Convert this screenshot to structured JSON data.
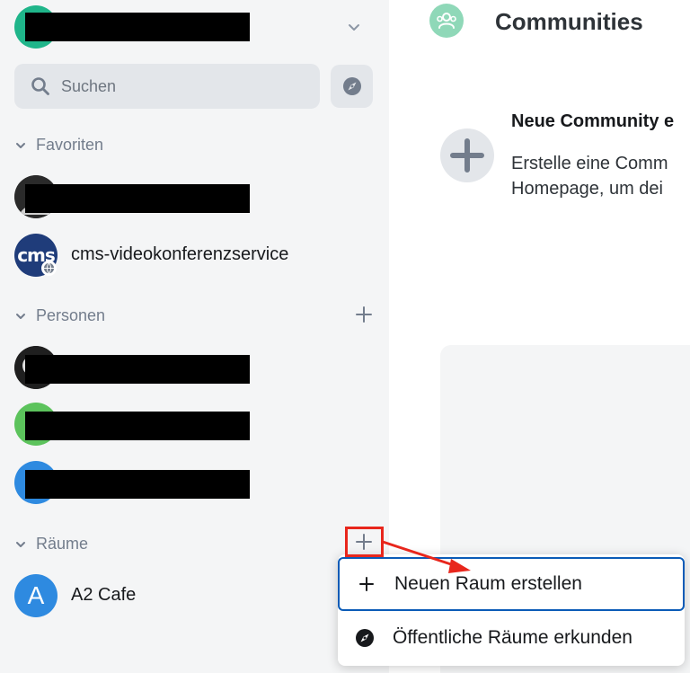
{
  "search": {
    "placeholder": "Suchen"
  },
  "sections": {
    "favorites": {
      "label": "Favoriten"
    },
    "people": {
      "label": "Personen"
    },
    "rooms": {
      "label": "Räume"
    }
  },
  "favorites": [
    {
      "label": ""
    },
    {
      "label": "cms-videokonferenzservice",
      "avatar_text": "cms"
    }
  ],
  "rooms": [
    {
      "label": "A2 Cafe",
      "avatar_letter": "A"
    }
  ],
  "main": {
    "title": "Communities",
    "card_title": "Neue Community e",
    "card_desc_line1": "Erstelle eine Comm",
    "card_desc_line2": "Homepage, um dei"
  },
  "context_menu": {
    "items": [
      {
        "label": "Neuen Raum erstellen",
        "icon": "plus-icon"
      },
      {
        "label": "Öffentliche Räume erkunden",
        "icon": "compass-icon"
      }
    ]
  },
  "colors": {
    "accent_green": "#1fb58a",
    "focus_blue": "#0b5bb7",
    "annotation_red": "#e8261c"
  }
}
